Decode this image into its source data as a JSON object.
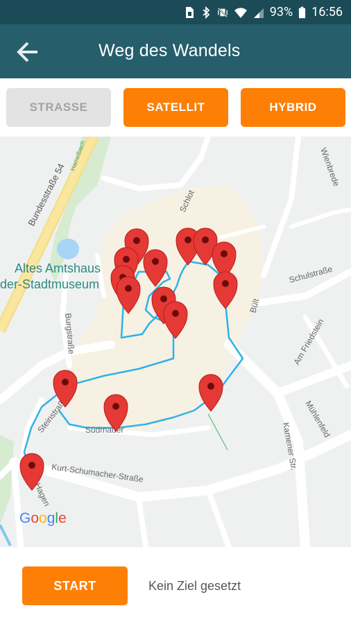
{
  "statusbar": {
    "battery": "93%",
    "time": "16:56"
  },
  "appbar": {
    "title": "Weg des Wandels"
  },
  "map_type": {
    "strasse": "STRASSE",
    "satellit": "SATELLIT",
    "hybrid": "HYBRID",
    "selected": "STRASSE"
  },
  "map": {
    "labels": {
      "bundesstrasse": "Bundesstraße 54",
      "hamelbach": "Hamelbach",
      "amtshaus_1": "Altes Amtshaus",
      "amtshaus_2": "der-Stadtmuseum",
      "schlot": "Schlot",
      "schulstrasse": "Schulstraße",
      "wienbrede": "Wienbrede",
      "buelt": "Bült",
      "am_friedstein": "Am Friedstein",
      "burgstrasse": "Burgstraße",
      "muehlenfeld": "Mühlenfeld",
      "steinstrasse": "Steinstraße",
      "suedmauer": "Südmauer",
      "kamener": "Kamener Str.",
      "kurt": "Kurt-Schumacher-Straße",
      "hagen": "Hagen"
    },
    "logo": "Google",
    "route_color": "#2eb2e6",
    "marker_color": "#e53935"
  },
  "footer": {
    "start_label": "START",
    "status": "Kein Ziel gesetzt"
  }
}
